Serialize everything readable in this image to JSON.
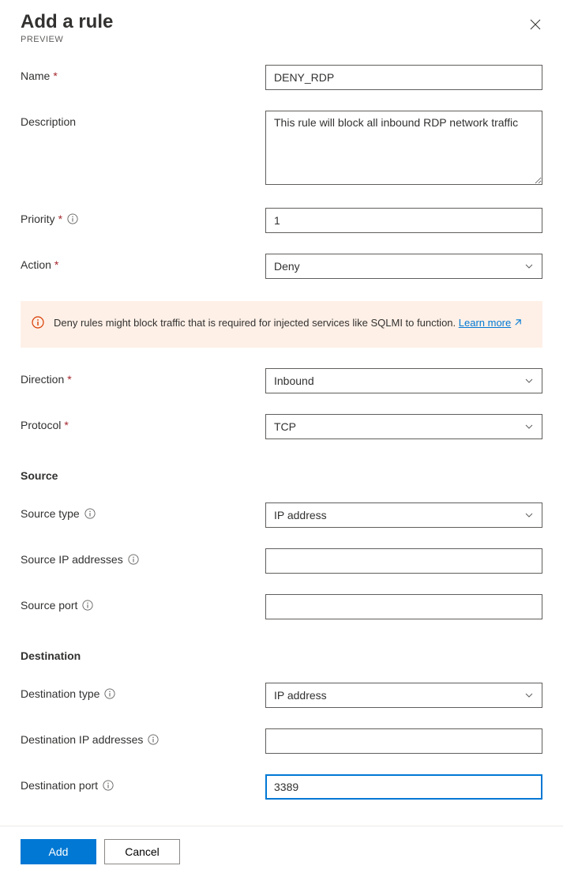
{
  "header": {
    "title": "Add a rule",
    "subtitle": "PREVIEW"
  },
  "fields": {
    "name": {
      "label": "Name",
      "value": "DENY_RDP"
    },
    "description": {
      "label": "Description",
      "value": "This rule will block all inbound RDP network traffic"
    },
    "priority": {
      "label": "Priority",
      "value": "1"
    },
    "action": {
      "label": "Action",
      "value": "Deny"
    },
    "direction": {
      "label": "Direction",
      "value": "Inbound"
    },
    "protocol": {
      "label": "Protocol",
      "value": "TCP"
    },
    "source_type": {
      "label": "Source type",
      "value": "IP address"
    },
    "source_ip": {
      "label": "Source IP addresses",
      "value": ""
    },
    "source_port": {
      "label": "Source port",
      "value": ""
    },
    "dest_type": {
      "label": "Destination type",
      "value": "IP address"
    },
    "dest_ip": {
      "label": "Destination IP addresses",
      "value": ""
    },
    "dest_port": {
      "label": "Destination port",
      "value": "3389"
    }
  },
  "infobar": {
    "text": "Deny rules might block traffic that is required for injected services like SQLMI to function. ",
    "link_text": "Learn more"
  },
  "sections": {
    "source": "Source",
    "destination": "Destination"
  },
  "footer": {
    "primary": "Add",
    "secondary": "Cancel"
  }
}
